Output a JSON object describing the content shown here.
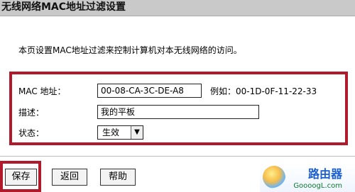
{
  "window": {
    "title": "无线网络MAC地址过滤设置"
  },
  "intro": {
    "text": "本页设置MAC地址过滤来控制计算机对本无线网络的访问。"
  },
  "form": {
    "mac_label": "MAC 地址：",
    "mac_value": "00-08-CA-3C-DE-A8",
    "mac_example": "例如：00-1D-0F-11-22-33",
    "desc_label": "描述：",
    "desc_value": "我的平板",
    "status_label": "状态：",
    "status_value": "生效"
  },
  "buttons": {
    "save": "保存",
    "back": "返回",
    "help": "帮助"
  },
  "watermark": {
    "brand": "路由器",
    "site": "GoooogL.com"
  },
  "colors": {
    "highlight": "#b11a2a",
    "title_bg": "#c9c9c9"
  }
}
